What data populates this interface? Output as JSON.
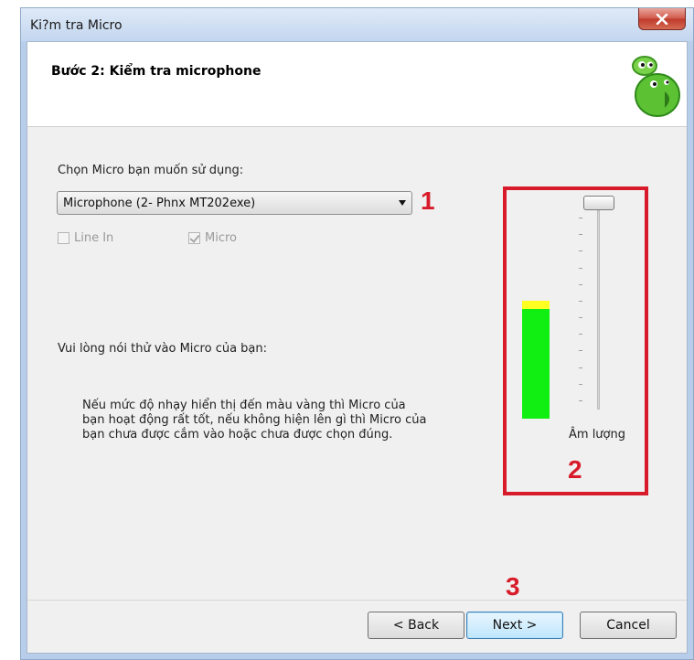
{
  "window": {
    "title": "Ki?m tra Micro"
  },
  "header": {
    "step_title": "Bước 2: Kiểm tra microphone"
  },
  "device": {
    "select_label": "Chọn Micro bạn muốn sử dụng:",
    "selected": "Microphone (2- Phnx MT202exe)"
  },
  "inputs": {
    "line_in": {
      "label": "Line In",
      "checked": false,
      "enabled": false
    },
    "micro": {
      "label": "Micro",
      "checked": true,
      "enabled": false
    }
  },
  "instructions": {
    "speak": "Vui lòng nói thử vào Micro của bạn:",
    "hint": "Nếu mức độ nhạy hiển thị đến màu vàng thì Micro của bạn hoạt động rất tốt, nếu không hiện lên gì thì Micro của bạn chưa được cắm vào hoặc chưa được chọn đúng."
  },
  "meter": {
    "level": 0.94,
    "peak_color": "#ffff22",
    "level_color": "#11ee11"
  },
  "volume": {
    "label": "Âm lượng",
    "value": 1.0,
    "ticks": 12
  },
  "annotations": {
    "a1": "1",
    "a2": "2",
    "a3": "3",
    "color": "#d81b2a"
  },
  "buttons": {
    "back": "< Back",
    "next": "Next >",
    "cancel": "Cancel"
  },
  "icons": {
    "close": "close-icon",
    "mascot": "chat-mascot-logo",
    "dropdown": "chevron-down-icon"
  }
}
